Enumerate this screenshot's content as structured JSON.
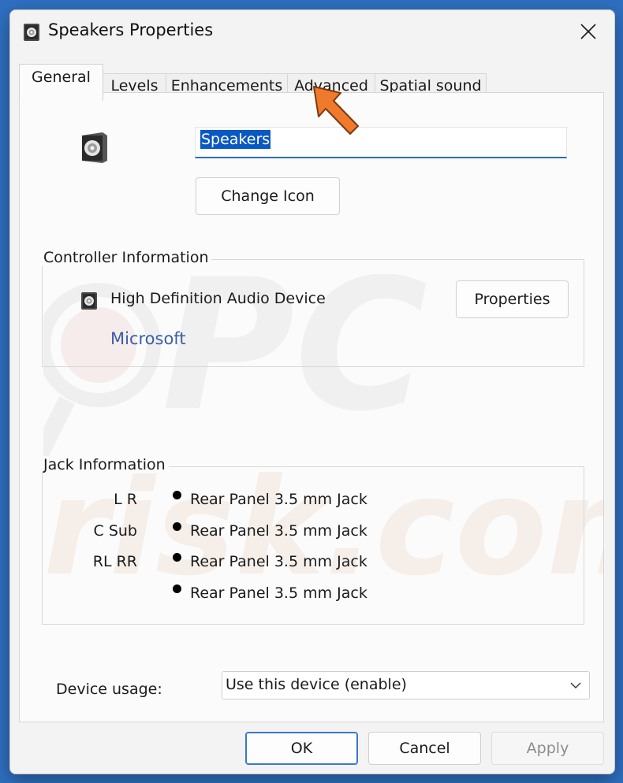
{
  "window": {
    "title": "Speakers Properties"
  },
  "tabs": [
    {
      "label": "General",
      "active": true
    },
    {
      "label": "Levels",
      "active": false
    },
    {
      "label": "Enhancements",
      "active": false
    },
    {
      "label": "Advanced",
      "active": false
    },
    {
      "label": "Spatial sound",
      "active": false
    }
  ],
  "general": {
    "device_name_value": "Speakers",
    "change_icon_label": "Change Icon"
  },
  "controller": {
    "group_label": "Controller Information",
    "device_name": "High Definition Audio Device",
    "manufacturer": "Microsoft",
    "properties_label": "Properties"
  },
  "jack": {
    "group_label": "Jack Information",
    "rows": [
      {
        "channels": "L R",
        "connector": "Rear Panel 3.5 mm Jack"
      },
      {
        "channels": "C Sub",
        "connector": "Rear Panel 3.5 mm Jack"
      },
      {
        "channels": "RL RR",
        "connector": "Rear Panel 3.5 mm Jack"
      },
      {
        "channels": "",
        "connector": "Rear Panel 3.5 mm Jack"
      }
    ]
  },
  "usage": {
    "label": "Device usage:",
    "selected": "Use this device (enable)"
  },
  "footer": {
    "ok_label": "OK",
    "cancel_label": "Cancel",
    "apply_label": "Apply"
  },
  "colors": {
    "accent": "#0a58c2",
    "link": "#3b5fa3",
    "annotation_arrow": "#f07a2c"
  }
}
